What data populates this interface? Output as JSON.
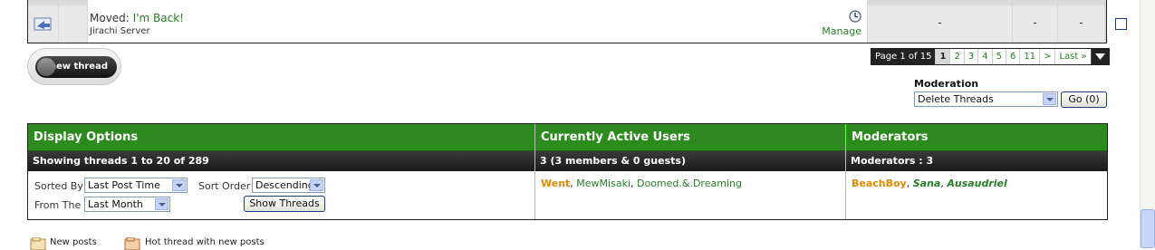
{
  "thread": {
    "prefix": "Moved:",
    "title": "I'm Back!",
    "author": "Jirachi Server",
    "manage_label": "Manage",
    "last_post": "-",
    "replies": "-",
    "views": "-"
  },
  "new_thread_label": "new thread",
  "pagenav": {
    "label": "Page 1 of 15",
    "pages": [
      "1",
      "2",
      "3",
      "4",
      "5",
      "6",
      "11",
      ">",
      "Last »"
    ],
    "current": "1"
  },
  "moderation": {
    "title": "Moderation",
    "selected": "Delete Threads",
    "go_label": "Go (0)"
  },
  "display_options": {
    "header": "Display Options",
    "subheader": "Showing threads 1 to 20 of 289",
    "sorted_by_label": "Sorted By",
    "sorted_by_value": "Last Post Time",
    "sort_order_label": "Sort Order",
    "sort_order_value": "Descending",
    "from_the_label": "From The",
    "from_the_value": "Last Month",
    "show_button": "Show Threads"
  },
  "active_users": {
    "header": "Currently Active Users",
    "subheader": "3 (3 members & 0 guests)",
    "users": [
      "Went",
      "MewMisaki",
      "Doomed.&.Dreaming"
    ]
  },
  "moderators": {
    "header": "Moderators",
    "subheader": "Moderators : 3",
    "users": [
      "BeachBoy",
      "Sana",
      "Ausaudriel"
    ]
  },
  "legend": {
    "new_posts": "New posts",
    "hot_thread": "Hot thread with new posts"
  },
  "colors": {
    "header_green": "#2d8a1e",
    "link_green": "#2a7d2a",
    "admin_orange": "#e08a00"
  }
}
